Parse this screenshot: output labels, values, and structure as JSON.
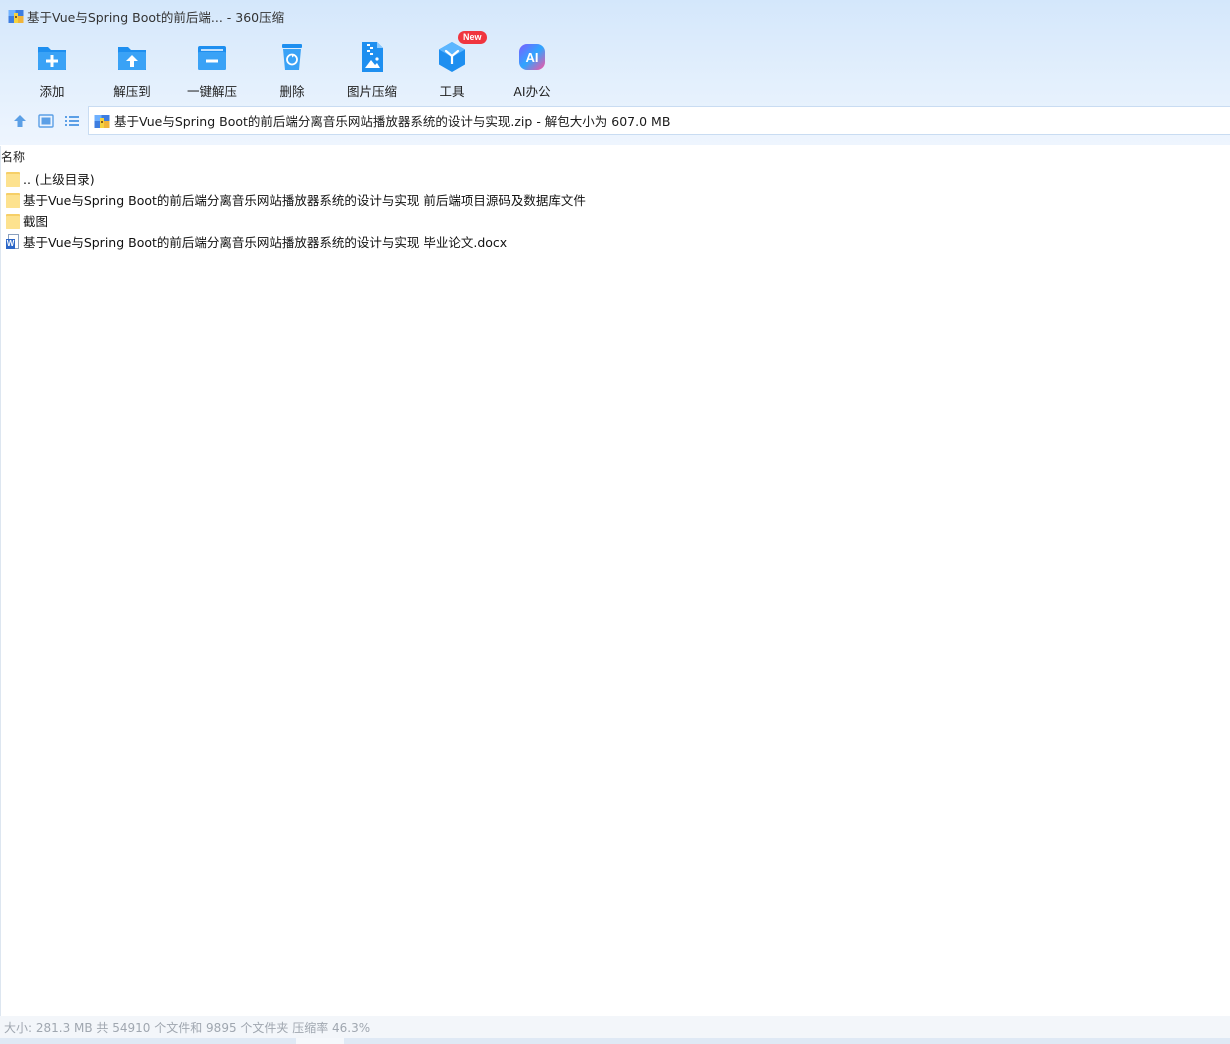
{
  "window": {
    "title": "基于Vue与Spring Boot的前后端... - 360压缩"
  },
  "toolbar": {
    "items": [
      {
        "label": "添加",
        "icon": "add-icon"
      },
      {
        "label": "解压到",
        "icon": "extract-to-icon"
      },
      {
        "label": "一键解压",
        "icon": "one-click-extract-icon"
      },
      {
        "label": "删除",
        "icon": "delete-icon"
      },
      {
        "label": "图片压缩",
        "icon": "image-compress-icon"
      },
      {
        "label": "工具",
        "icon": "tools-icon",
        "badge": "New"
      },
      {
        "label": "AI办公",
        "icon": "ai-office-icon",
        "glyph": "AI"
      }
    ]
  },
  "address": {
    "text": "基于Vue与Spring Boot的前后端分离音乐网站播放器系统的设计与实现.zip - 解包大小为 607.0 MB"
  },
  "list": {
    "column_name": "名称",
    "rows": [
      {
        "label": ".. (上级目录)",
        "type": "folder"
      },
      {
        "label": "基于Vue与Spring Boot的前后端分离音乐网站播放器系统的设计与实现 前后端项目源码及数据库文件",
        "type": "folder"
      },
      {
        "label": "截图",
        "type": "folder"
      },
      {
        "label": "基于Vue与Spring Boot的前后端分离音乐网站播放器系统的设计与实现 毕业论文.docx",
        "type": "docx",
        "glyph": "W"
      }
    ]
  },
  "status": {
    "text": "大小: 281.3 MB 共 54910 个文件和 9895 个文件夹 压缩率 46.3%"
  },
  "colors": {
    "accent": "#1e8ff0",
    "folder": "#fde28f",
    "badge": "#f0353f"
  }
}
